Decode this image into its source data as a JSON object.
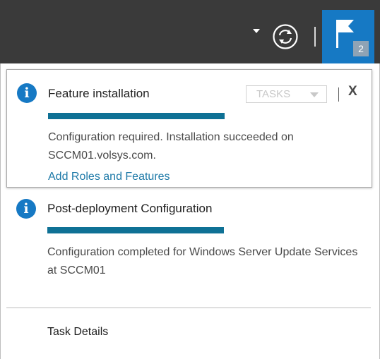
{
  "toolbar": {
    "caret_icon": "chevron-down-icon",
    "refresh_icon": "refresh-icon",
    "flag_icon": "flag-icon",
    "notification_count": "2",
    "colors": {
      "toolbar_bg": "#3a3a3a",
      "flag_bg": "#1679c4",
      "badge_bg": "#8fa3b5"
    }
  },
  "notifications": [
    {
      "title": "Feature installation",
      "info_icon_glyph": "i",
      "progress_fraction": 1.0,
      "description": "Configuration required. Installation succeeded on SCCM01.volsys.com.",
      "link": "Add Roles and Features",
      "tasks_label": "TASKS",
      "close_glyph": "X"
    },
    {
      "title": "Post-deployment Configuration",
      "info_icon_glyph": "i",
      "progress_fraction": 1.0,
      "description": "Configuration completed for Windows Server Update Services at SCCM01"
    }
  ],
  "footer": {
    "task_details": "Task Details"
  },
  "colors": {
    "accent": "#1679c4",
    "progress": "#0f7195",
    "link": "#1e7aa8"
  }
}
